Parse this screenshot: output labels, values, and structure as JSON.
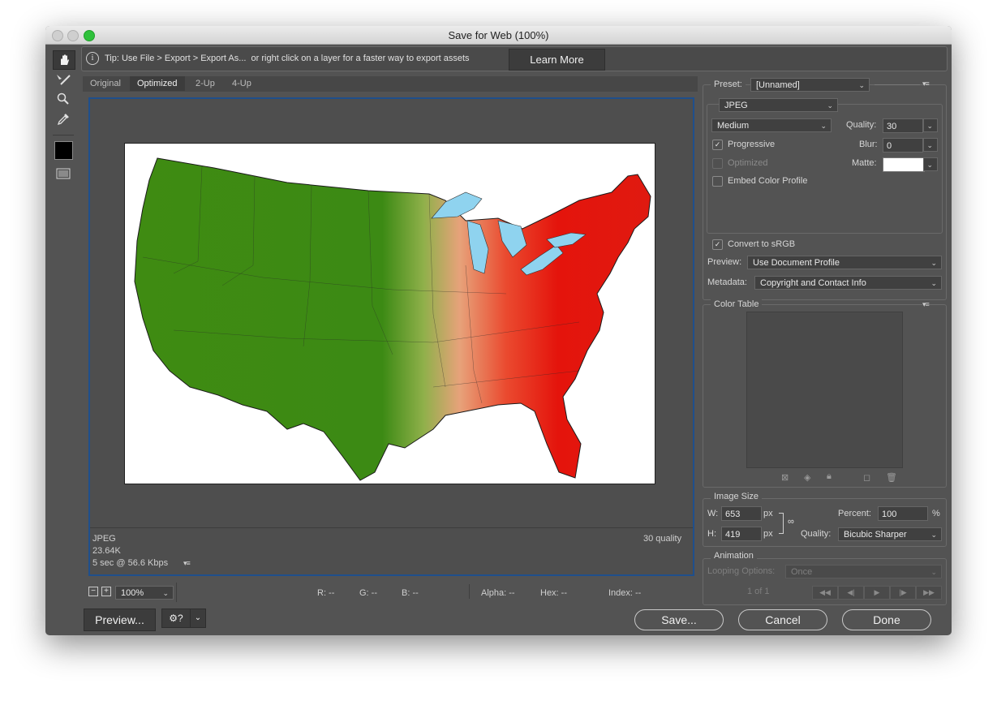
{
  "window": {
    "title": "Save for Web (100%)"
  },
  "tip": {
    "text": "Tip: Use File > Export > Export As...  or right click on a layer for a faster way to export assets",
    "learn_more": "Learn More"
  },
  "tabs": [
    "Original",
    "Optimized",
    "2-Up",
    "4-Up"
  ],
  "active_tab": "Optimized",
  "image_info": {
    "format": "JPEG",
    "size": "23.64K",
    "time": "5 sec @ 56.6 Kbps",
    "quality_note": "30 quality"
  },
  "bottom": {
    "zoom": "100%",
    "r": "R: --",
    "g": "G: --",
    "b": "B: --",
    "alpha": "Alpha: --",
    "hex": "Hex: --",
    "index": "Index: --"
  },
  "buttons": {
    "preview": "Preview...",
    "save": "Save...",
    "cancel": "Cancel",
    "done": "Done"
  },
  "settings": {
    "preset_label": "Preset:",
    "preset_value": "[Unnamed]",
    "format": "JPEG",
    "compression": "Medium",
    "quality_label": "Quality:",
    "quality_value": "30",
    "progressive_label": "Progressive",
    "progressive_checked": true,
    "blur_label": "Blur:",
    "blur_value": "0",
    "optimized_label": "Optimized",
    "optimized_checked": false,
    "matte_label": "Matte:",
    "embed_label": "Embed Color Profile",
    "embed_checked": false,
    "convert_label": "Convert to sRGB",
    "convert_checked": true,
    "preview_label": "Preview:",
    "preview_value": "Use Document Profile",
    "metadata_label": "Metadata:",
    "metadata_value": "Copyright and Contact Info"
  },
  "color_table": {
    "title": "Color Table"
  },
  "image_size": {
    "title": "Image Size",
    "w_label": "W:",
    "w_value": "653",
    "h_label": "H:",
    "h_value": "419",
    "unit": "px",
    "percent_label": "Percent:",
    "percent_value": "100",
    "percent_unit": "%",
    "quality_label": "Quality:",
    "quality_value": "Bicubic Sharper"
  },
  "animation": {
    "title": "Animation",
    "looping_label": "Looping Options:",
    "looping_value": "Once",
    "frame": "1 of 1"
  },
  "colors": {
    "window_bg": "#535353",
    "canvas_border": "#1f4f8c",
    "foreground_swatch": "#000000",
    "map_green": "#3f8b12",
    "map_red": "#e4140c",
    "lakes": "#8fd3ef"
  }
}
